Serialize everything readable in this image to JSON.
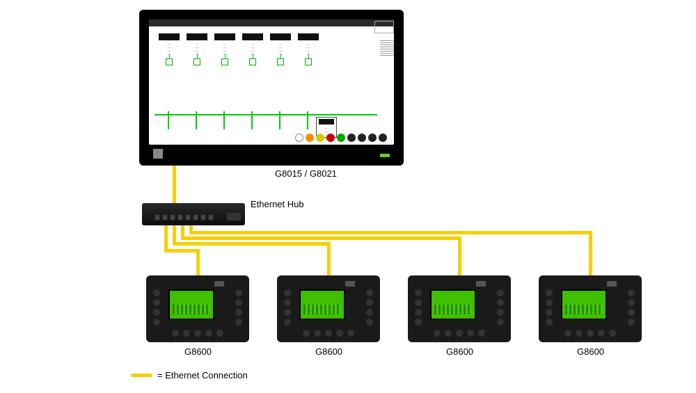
{
  "monitor": {
    "caption": "G8015 / G8021"
  },
  "hub": {
    "label": "Ethernet Hub"
  },
  "controllers": [
    {
      "caption": "G8600"
    },
    {
      "caption": "G8600"
    },
    {
      "caption": "G8600"
    },
    {
      "caption": "G8600"
    }
  ],
  "legend": {
    "text": "= Ethernet Connection"
  },
  "colors": {
    "cable": "#f6cf00",
    "screen_green": "#3fbf00",
    "scada_green": "#0c0"
  }
}
